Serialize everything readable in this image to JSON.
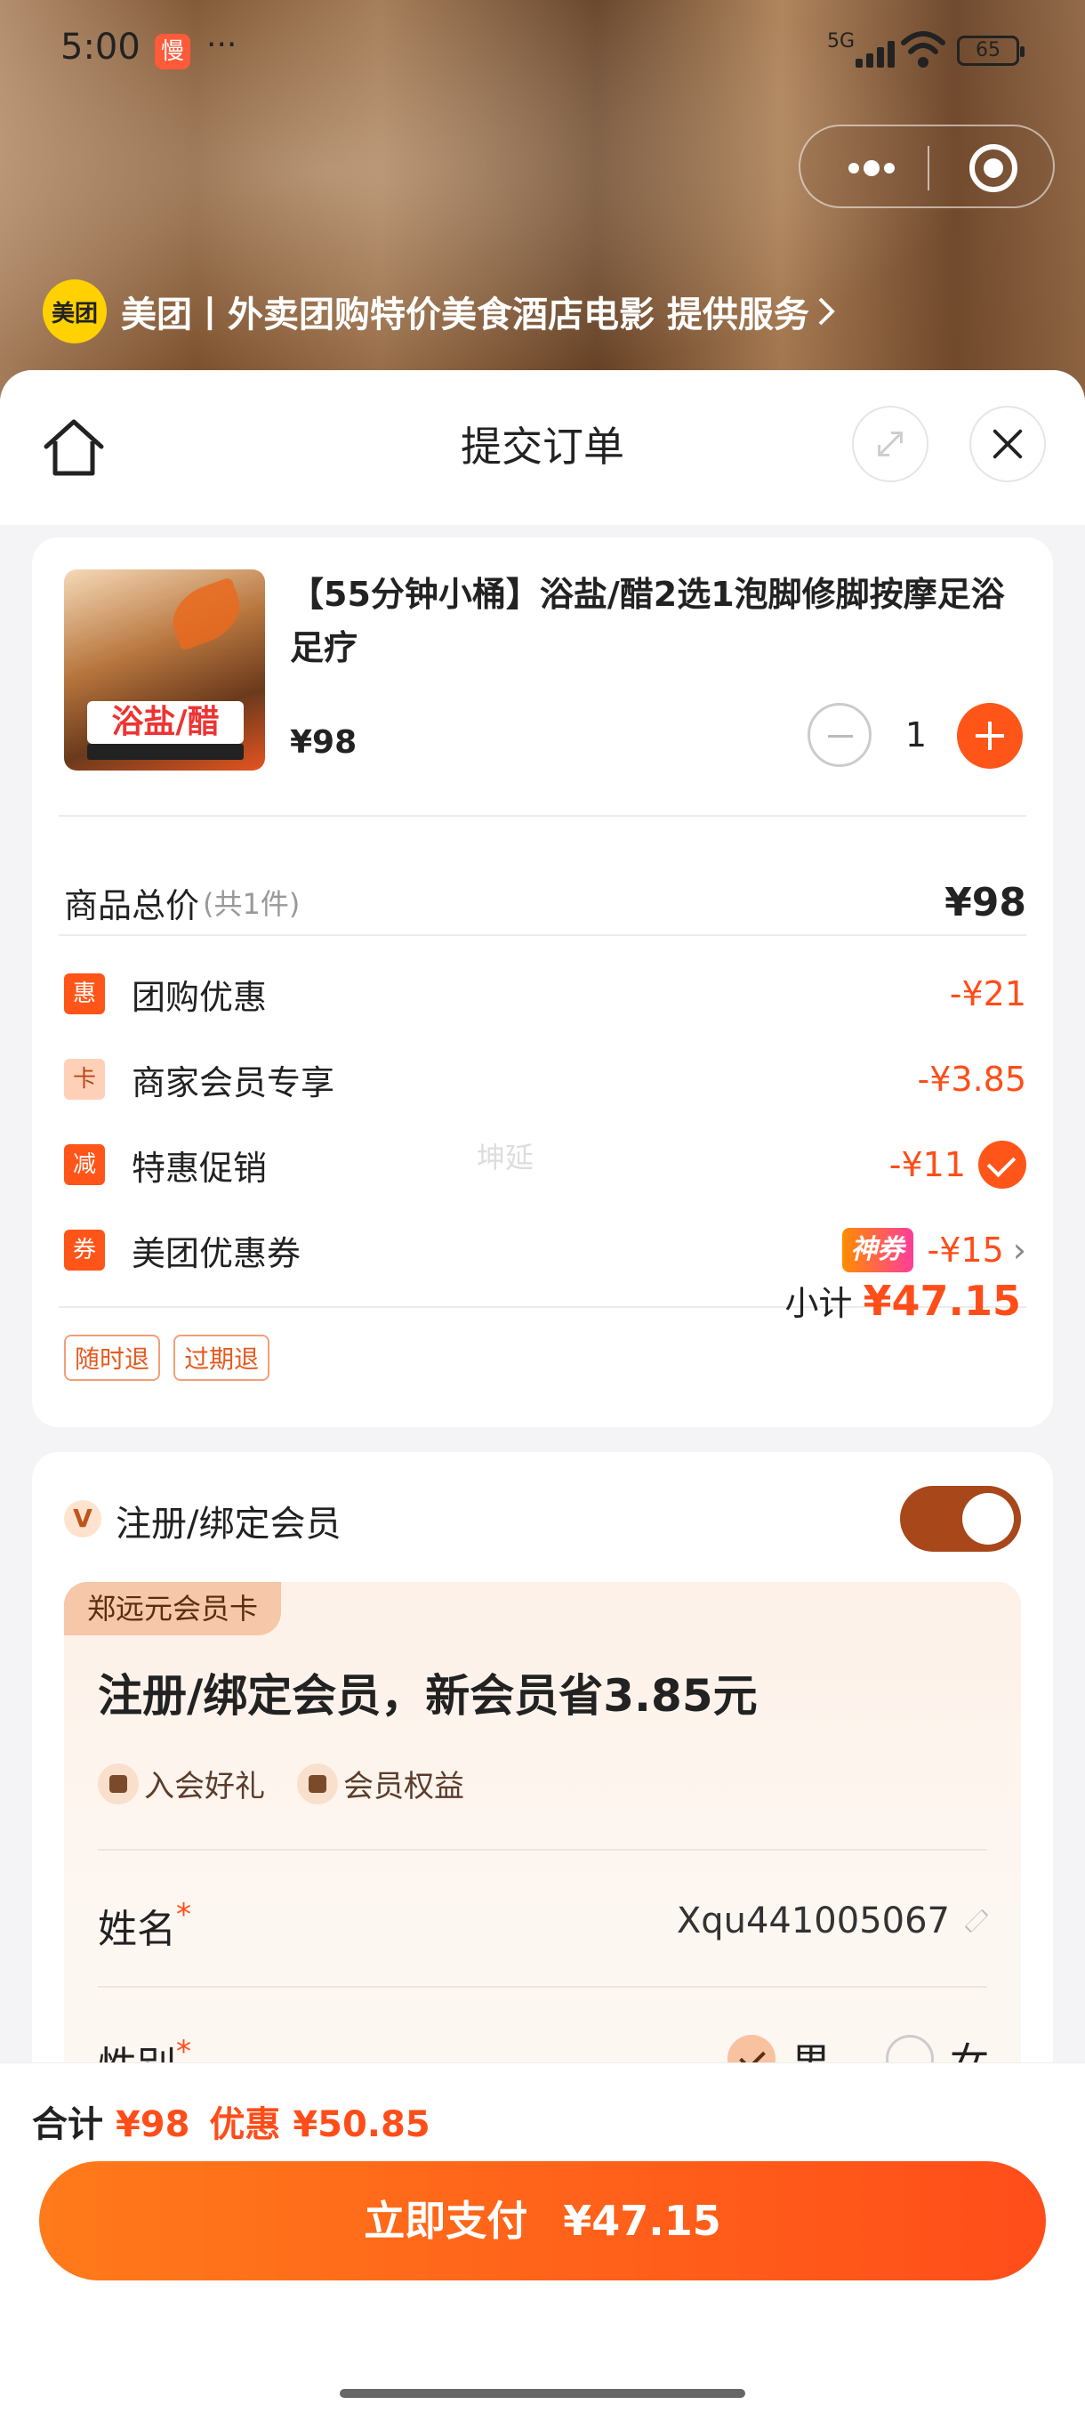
{
  "status": {
    "time": "5:00",
    "app_badge": "慢",
    "dots": "···",
    "network": "5G",
    "battery": "65"
  },
  "brand": {
    "logo_text": "美团",
    "text": "美团丨外卖团购特价美食酒店电影 提供服务"
  },
  "header": {
    "title": "提交订单"
  },
  "product": {
    "thumb_label": "浴盐/醋",
    "name": "【55分钟小桶】浴盐/醋2选1泡脚修脚按摩足浴足疗",
    "price": "¥98",
    "quantity": "1"
  },
  "summary": {
    "total_label": "商品总价",
    "total_count": "(共1件)",
    "total_value": "¥98",
    "discounts": [
      {
        "tag": "惠",
        "label": "团购优惠",
        "value": "-¥21"
      },
      {
        "tag": "卡",
        "label": "商家会员专享",
        "value": "-¥3.85"
      },
      {
        "tag": "减",
        "label": "特惠促销",
        "value": "-¥11"
      },
      {
        "tag": "券",
        "label": "美团优惠券",
        "badge": "神券",
        "value": "-¥15"
      }
    ],
    "watermark": "坤延",
    "policies": [
      "随时退",
      "过期退"
    ],
    "subtotal_label": "小计",
    "subtotal_value": "¥47.15"
  },
  "membership": {
    "badge": "V",
    "label": "注册/绑定会员",
    "toggle_on": true,
    "card_tag": "郑远元会员卡",
    "title": "注册/绑定会员，新会员省3.85元",
    "perks": [
      "入会好礼",
      "会员权益"
    ],
    "name_label": "姓名",
    "name_value": "Xqu441005067",
    "gender_label": "性别",
    "gender_options": [
      "男",
      "女"
    ],
    "required_mark": "*"
  },
  "footer": {
    "total_label": "合计",
    "total_value": "¥98",
    "discount_label": "优惠",
    "discount_value": "¥50.85",
    "pay_label": "立即支付",
    "pay_value": "¥47.15"
  },
  "colors": {
    "accent": "#ff4d1a",
    "toggle": "#a8471a",
    "brand_yellow": "#ffd100"
  }
}
